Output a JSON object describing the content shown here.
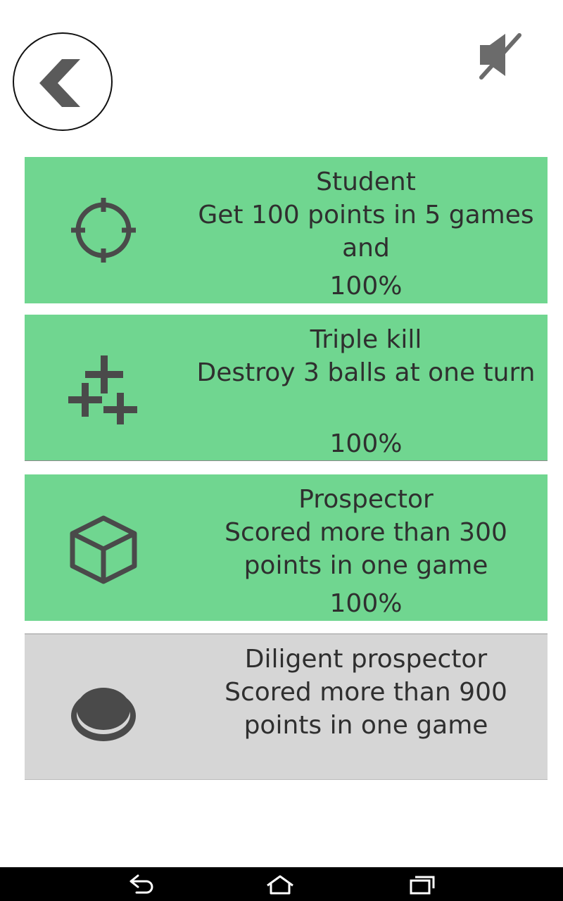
{
  "colors": {
    "completed_card": "#70d690",
    "locked_card": "#d6d6d6",
    "text": "#2f2f2f",
    "icon": "#4a4a4a"
  },
  "header": {
    "back_icon": "chevron-left-icon",
    "sound_icon": "speaker-muted-icon"
  },
  "achievements": [
    {
      "title": "Student",
      "description": "Get 100 points in 5 games and",
      "percent": "100%",
      "icon": "crosshair-icon",
      "completed": true
    },
    {
      "title": "Triple kill",
      "description": "Destroy 3 balls at one turn",
      "percent": "100%",
      "icon": "triple-plus-icon",
      "completed": true
    },
    {
      "title": "Prospector",
      "description": "Scored more than 300 points in one game",
      "percent": "100%",
      "icon": "cube-icon",
      "completed": true
    },
    {
      "title": "Diligent prospector",
      "description": "Scored more than 900 points in one game",
      "percent": "",
      "icon": "button-icon",
      "completed": false
    }
  ],
  "navbar": {
    "back": "nav-back-icon",
    "home": "nav-home-icon",
    "recents": "nav-recents-icon"
  }
}
